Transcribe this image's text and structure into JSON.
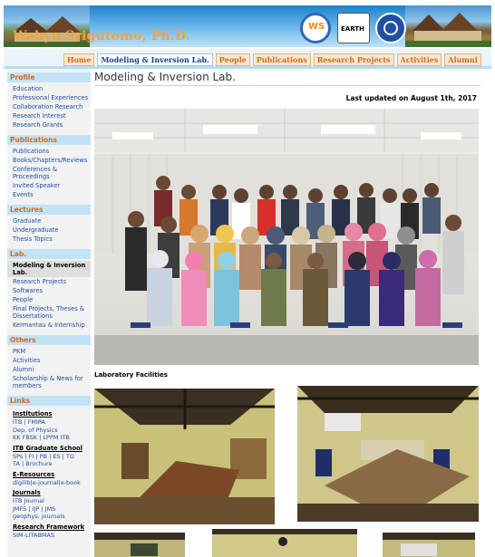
{
  "header": {
    "site_title": "Wahyu Srigutomo, Ph.D.",
    "logos": [
      {
        "name": "ws-logo",
        "text": "WS"
      },
      {
        "name": "earth-logo",
        "text": "EARTH"
      },
      {
        "name": "itb-logo",
        "text": ""
      }
    ]
  },
  "nav": {
    "items": [
      {
        "label": "Home",
        "active": false
      },
      {
        "label": "Modeling & Inversion Lab.",
        "active": true
      },
      {
        "label": "People",
        "active": false
      },
      {
        "label": "Publications",
        "active": false
      },
      {
        "label": "Research Projects",
        "active": false
      },
      {
        "label": "Activities",
        "active": false
      },
      {
        "label": "Alumni",
        "active": false
      }
    ]
  },
  "sidebar": {
    "profile": {
      "heading": "Profile",
      "items": [
        "Education",
        "Professional Experiences",
        "Collaboration Research",
        "Research Interest",
        "Research Grants"
      ]
    },
    "publications": {
      "heading": "Publications",
      "items": [
        "Publications",
        "Books/Chapters/Reviews",
        "Conferences & Proceedings",
        "Invited Speaker",
        "Events"
      ]
    },
    "lectures": {
      "heading": "Lectures",
      "items": [
        "Graduate",
        "Undergraduate",
        "Thesis Topics"
      ]
    },
    "lab": {
      "heading": "Lab.",
      "current": "Modeling & Inversion Lab.",
      "items": [
        "Research Projects",
        "Softwares",
        "People",
        "Final Projects, Theses & Dissertations",
        "Kermantau & Internship"
      ]
    },
    "others": {
      "heading": "Others",
      "items": [
        "PKM",
        "Activities",
        "Alumni",
        "Scholarship & News for members"
      ]
    },
    "links": {
      "heading": "Links",
      "institutions": {
        "title": "Institutions",
        "lines": [
          "ITB | FMIPA",
          "Dep. of Physics",
          "KK FBSK | LPPM ITB"
        ]
      },
      "graduate_school": {
        "title": "ITB Graduate School",
        "lines": [
          "SPs | FI | PB | ES | TG",
          "TA | Brochure"
        ]
      },
      "eresources": {
        "title": "E-Resources",
        "lines": [
          "digilib|e-journal|e-book"
        ]
      },
      "journals": {
        "title": "Journals",
        "lines": [
          "ITB Journal",
          "JMFS | IJP | JMS",
          "geophys. journals"
        ]
      },
      "research_framework": {
        "title": "Research Framework",
        "lines": [
          "SIM-LITABMAS"
        ]
      }
    }
  },
  "main": {
    "page_title": "Modeling & Inversion Lab.",
    "last_updated": "Last updated on August 1th, 2017",
    "facilities_label": "Laboratory Facilities"
  },
  "colors": {
    "nav_text": "#d2691e",
    "nav_active_text": "#143f84",
    "sidebar_heading_bg": "#c2e3f5",
    "sidebar_heading_text": "#d2691e",
    "link": "#1e4fa0",
    "title_text": "#f2a33a"
  }
}
